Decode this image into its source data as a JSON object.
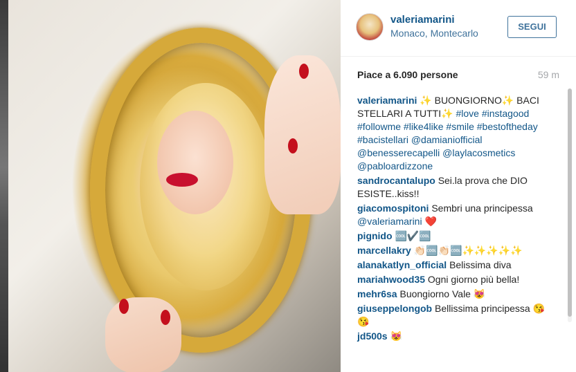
{
  "post": {
    "username": "valeriamarini",
    "location": "Monaco, Montecarlo",
    "follow_label": "SEGUI",
    "likes_text": "Piace a 6.090 persone",
    "time_ago": "59 m"
  },
  "caption": {
    "user": "valeriamarini",
    "text_1": "✨ BUONGIORNO",
    "text_2": "✨ BACI STELLARI A TUTTI",
    "text_3": "✨",
    "tags": [
      "#love",
      "#instagood",
      "#followme",
      "#like4like",
      "#smile",
      "#bestoftheday",
      "#bacistellari",
      "@damianiofficial",
      "@benesserecapelli",
      "@laylacosmetics",
      "@pabloardizzone"
    ]
  },
  "comments": [
    {
      "user": "sandrocantalupo",
      "text": "Sei.la prova che DIO ESISTE..kiss!!"
    },
    {
      "user": "giacomospitoni",
      "text": "Sembri una principessa",
      "mention": "@valeriamarini",
      "emoji": "❤️"
    },
    {
      "user": "pignido",
      "text": "🆒✔️🆒"
    },
    {
      "user": "marcellakry",
      "text": "👏🏻🆒👏🏻🆒✨✨✨✨✨"
    },
    {
      "user": "alanakatlyn_official",
      "text": "Belissima diva"
    },
    {
      "user": "mariahwood35",
      "text": "Ogni giorno più bella!"
    },
    {
      "user": "mehr6sa",
      "text": "Buongiorno Vale 😻"
    },
    {
      "user": "giuseppelongob",
      "text": "Bellissima principessa 😘😘"
    },
    {
      "user": "jd500s",
      "text": "😻"
    }
  ],
  "colors": {
    "link": "#125688",
    "accent": "#3f729b",
    "muted": "#a5a7aa"
  }
}
